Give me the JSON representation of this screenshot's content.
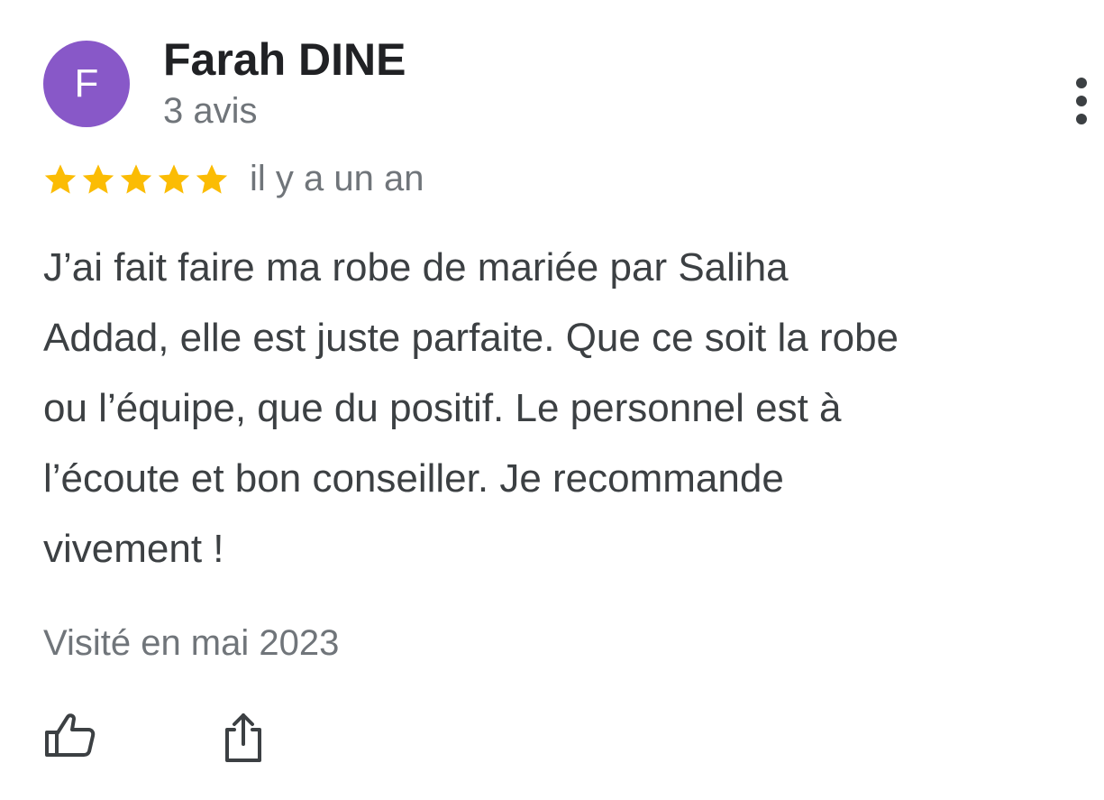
{
  "review": {
    "author": {
      "initial": "F",
      "name": "Farah DINE",
      "review_count": "3 avis",
      "avatar_color": "#8858c8"
    },
    "rating": {
      "stars": 5,
      "max": 5,
      "star_color": "#fbbc04"
    },
    "date": "il y a un an",
    "text_lines": [
      "J’ai fait faire ma robe de mariée par Saliha",
      "Addad, elle est juste parfaite. Que ce soit la robe",
      "ou l’équipe, que du positif. Le personnel est à",
      "l’écoute et bon conseiller. Je recommande",
      "vivement !"
    ],
    "visit": "Visité en mai 2023",
    "actions": {
      "like_icon": "thumbs-up-icon",
      "share_icon": "share-icon",
      "more_icon": "more-vert-icon"
    }
  }
}
